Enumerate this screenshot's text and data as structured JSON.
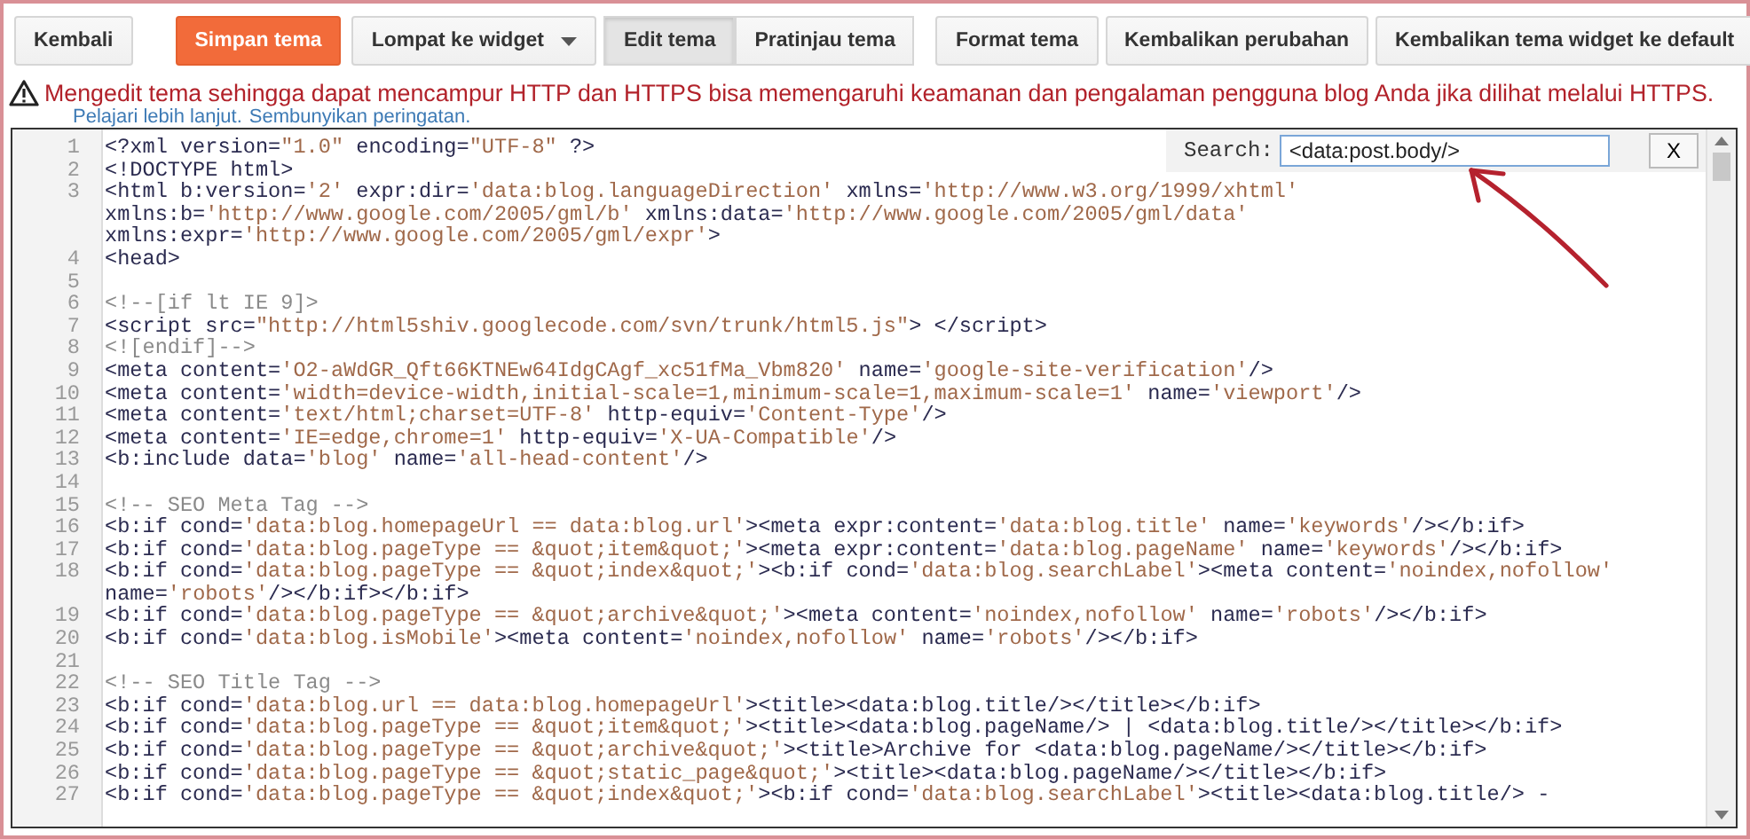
{
  "toolbar": {
    "buttons": [
      {
        "label": "Kembali",
        "kind": "plain"
      },
      {
        "label": "Simpan tema",
        "kind": "primary"
      },
      {
        "label": "Lompat ke widget",
        "kind": "dropdown"
      }
    ],
    "mode_tabs": [
      {
        "label": "Edit tema",
        "selected": true
      },
      {
        "label": "Pratinjau tema",
        "selected": false
      }
    ],
    "actions": [
      "Format tema",
      "Kembalikan perubahan",
      "Kembalikan tema widget ke default"
    ]
  },
  "warning": {
    "message": "Mengedit tema sehingga dapat mencampur HTTP dan HTTPS bisa memengaruhi keamanan dan pengalaman pengguna blog Anda jika dilihat melalui HTTPS.",
    "links": [
      "Pelajari lebih lanjut.",
      "Sembunyikan peringatan."
    ]
  },
  "editor": {
    "search": {
      "label": "Search:",
      "value": "<data:post.body/>",
      "close": "X"
    },
    "lines": [
      {
        "number": "1",
        "text": "<?xml version=\"1.0\" encoding=\"UTF-8\" ?>"
      },
      {
        "number": "2",
        "text": "<!DOCTYPE html>"
      },
      {
        "number": "3",
        "text": "<html b:version='2' expr:dir='data:blog.languageDirection' xmlns='http://www.w3.org/1999/xhtml'",
        "wrapped": [
          "xmlns:b='http://www.google.com/2005/gml/b' xmlns:data='http://www.google.com/2005/gml/data'",
          "xmlns:expr='http://www.google.com/2005/gml/expr'>"
        ]
      },
      {
        "number": "4",
        "text": "<head>"
      },
      {
        "number": "5"
      },
      {
        "number": "6",
        "text": "<!--[if lt IE 9]>"
      },
      {
        "number": "7",
        "text": "<script src=\"http://html5shiv.googlecode.com/svn/trunk/html5.js\"> </script>"
      },
      {
        "number": "8",
        "text": "<![endif]-->"
      },
      {
        "number": "9",
        "text": "<meta content='O2-aWdGR_Qft66KTNEw64IdgCAgf_xc51fMa_Vbm820' name='google-site-verification'/>"
      },
      {
        "number": "10",
        "text": "<meta content='width=device-width,initial-scale=1,minimum-scale=1,maximum-scale=1' name='viewport'/>"
      },
      {
        "number": "11",
        "text": "<meta content='text/html;charset=UTF-8' http-equiv='Content-Type'/>"
      },
      {
        "number": "12",
        "text": "<meta content='IE=edge,chrome=1' http-equiv='X-UA-Compatible'/>"
      },
      {
        "number": "13",
        "text": "<b:include data='blog' name='all-head-content'/>"
      },
      {
        "number": "14"
      },
      {
        "number": "15",
        "text": "<!-- SEO Meta Tag -->"
      },
      {
        "number": "16",
        "text": "<b:if cond='data:blog.homepageUrl == data:blog.url'><meta expr:content='data:blog.title' name='keywords'/></b:if>"
      },
      {
        "number": "17",
        "text": "<b:if cond='data:blog.pageType == &quot;item&quot;'><meta expr:content='data:blog.pageName' name='keywords'/></b:if>"
      },
      {
        "number": "18",
        "text": "<b:if cond='data:blog.pageType == &quot;index&quot;'><b:if cond='data:blog.searchLabel'><meta content='noindex,nofollow'",
        "wrapped": [
          "name='robots'/></b:if></b:if>"
        ]
      },
      {
        "number": "19",
        "text": "<b:if cond='data:blog.pageType == &quot;archive&quot;'><meta content='noindex,nofollow' name='robots'/></b:if>"
      },
      {
        "number": "20",
        "text": "<b:if cond='data:blog.isMobile'><meta content='noindex,nofollow' name='robots'/></b:if>"
      },
      {
        "number": "21"
      },
      {
        "number": "22",
        "text": "<!-- SEO Title Tag -->"
      },
      {
        "number": "23",
        "text": "<b:if cond='data:blog.url == data:blog.homepageUrl'><title><data:blog.title/></title></b:if>"
      },
      {
        "number": "24",
        "text": "<b:if cond='data:blog.pageType == &quot;item&quot;'><title><data:blog.pageName/> | <data:blog.title/></title></b:if>"
      },
      {
        "number": "25",
        "text": "<b:if cond='data:blog.pageType == &quot;archive&quot;'><title>Archive for <data:blog.pageName/></title></b:if>"
      },
      {
        "number": "26",
        "text": "<b:if cond='data:blog.pageType == &quot;static_page&quot;'><title><data:blog.pageName/></title></b:if>"
      },
      {
        "number": "27",
        "text": "<b:if cond='data:blog.pageType == &quot;index&quot;'><b:if cond='data:blog.searchLabel'><title><data:blog.title/> -"
      }
    ]
  }
}
